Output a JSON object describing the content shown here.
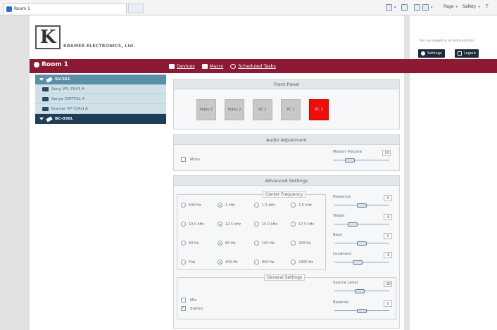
{
  "browser": {
    "tab_title": "Room 1",
    "toolbar_page": "Page",
    "toolbar_safety": "Safety",
    "toolbar_tools": "T"
  },
  "header": {
    "brand": "KRAMER ELECTRONICS, Ltd.",
    "logged_in": "You are logged in as Administrator",
    "settings_label": "Settings",
    "logout_label": "Logout"
  },
  "room": {
    "title": "Room 1"
  },
  "nav": {
    "devices": "Devices",
    "macro": "Macro",
    "scheduled": "Scheduled Tasks"
  },
  "tree": {
    "group1": "SV-551",
    "children": [
      "Sony VPL PX41 A",
      "Sanyo DWT50L A",
      "Kramer VP-724xl A"
    ],
    "group2": "BC-030L"
  },
  "front_panel": {
    "title": "Front Panel",
    "buttons": [
      "Video 1",
      "Video 2",
      "PC 1",
      "PC 2",
      "PC 3"
    ],
    "active_index": 4
  },
  "audio": {
    "title": "Audio Adjustment",
    "mute_label": "Mute",
    "master_label": "Master Volume",
    "master_value": "-55",
    "master_level": 0.25
  },
  "advanced": {
    "title": "Advanced Settings",
    "center_freq_label": "Center Frequency",
    "freq_rows": [
      [
        "500 Hz",
        "1 kHz",
        "1.5 kHz",
        "2.5 kHz"
      ],
      [
        "10.0 kHz",
        "12.5 kHz",
        "15.0 kHz",
        "17.5 kHz"
      ],
      [
        "60 Hz",
        "80 Hz",
        "100 Hz",
        "200 Hz"
      ],
      [
        "Flat",
        "400 Hz",
        "800 Hz",
        "2400 Hz"
      ]
    ],
    "selected_col": 1,
    "sliders": [
      {
        "label": "Presence",
        "value": "0",
        "level": 0.5
      },
      {
        "label": "Treble",
        "value": "-8",
        "level": 0.3
      },
      {
        "label": "Bass",
        "value": "0",
        "level": 0.5
      },
      {
        "label": "Loudness",
        "value": "-8",
        "level": 0.4
      }
    ],
    "general_label": "General Settings",
    "mix_label": "Mix",
    "stereo_label": "Stereo",
    "source_level_label": "Source Level",
    "source_level_value": "-30",
    "source_level_level": 0.45,
    "balance_label": "Balance",
    "balance_value": "0",
    "balance_level": 0.5
  }
}
